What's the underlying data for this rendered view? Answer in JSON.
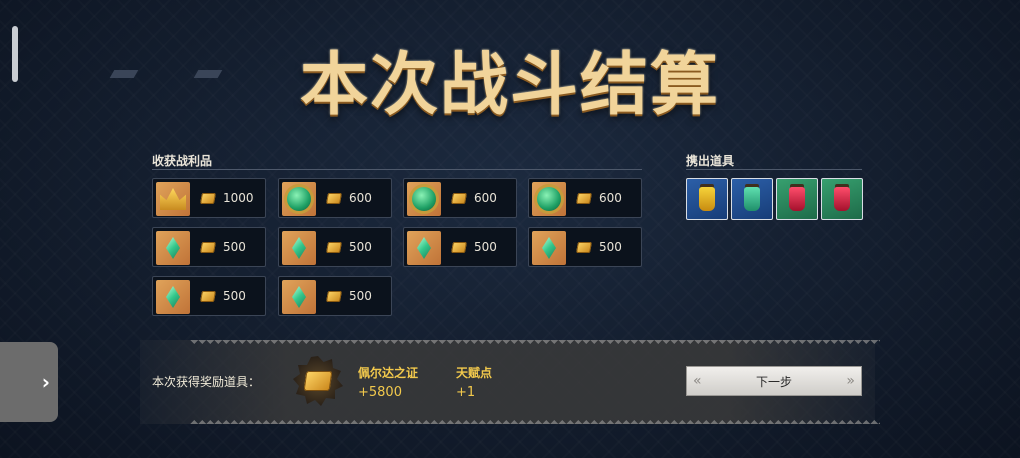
{
  "title": "本次战斗结算",
  "loot": {
    "heading": "收获战利品",
    "items": [
      {
        "icon": "crown-icon",
        "amount": "1000"
      },
      {
        "icon": "emerald-medallion-icon",
        "amount": "600"
      },
      {
        "icon": "emerald-medallion-icon",
        "amount": "600"
      },
      {
        "icon": "emerald-medallion-icon",
        "amount": "600"
      },
      {
        "icon": "green-crystal-icon",
        "amount": "500"
      },
      {
        "icon": "green-crystal-icon",
        "amount": "500"
      },
      {
        "icon": "green-crystal-icon",
        "amount": "500"
      },
      {
        "icon": "green-crystal-icon",
        "amount": "500"
      },
      {
        "icon": "green-crystal-icon",
        "amount": "500"
      },
      {
        "icon": "green-crystal-icon",
        "amount": "500"
      }
    ]
  },
  "drops": {
    "heading": "携出道具",
    "items": [
      {
        "icon": "yellow-potion-icon",
        "frame": "blue"
      },
      {
        "icon": "green-potion-icon",
        "frame": "blue"
      },
      {
        "icon": "red-potion-icon",
        "frame": "green"
      },
      {
        "icon": "red-potion-icon",
        "frame": "green"
      }
    ]
  },
  "reward": {
    "label": "本次获得奖励道具：",
    "currency_name": "佩尔达之证",
    "currency_value": "+5800",
    "talent_name": "天赋点",
    "talent_value": "+1"
  },
  "next_button": "下一步",
  "side_tab_icon": "chevron-right-icon",
  "colors": {
    "gold_text": "#f2c94c",
    "title": "#f1d49a"
  }
}
